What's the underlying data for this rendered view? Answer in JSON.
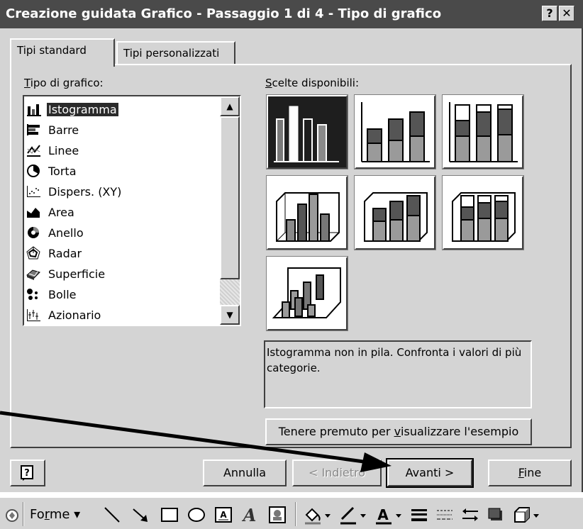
{
  "window": {
    "title": "Creazione guidata Grafico - Passaggio 1 di 4 - Tipo di grafico",
    "help_glyph": "?",
    "close_glyph": "✕"
  },
  "tabs": [
    {
      "label": "Tipi standard",
      "active": true
    },
    {
      "label": "Tipi personalizzati",
      "active": false
    }
  ],
  "chart_type_list": {
    "label_mnemonic": "T",
    "label_rest": "ipo di grafico:",
    "items": [
      {
        "label": "Istogramma",
        "icon": "column-chart-icon",
        "selected": true
      },
      {
        "label": "Barre",
        "icon": "bar-chart-icon"
      },
      {
        "label": "Linee",
        "icon": "line-chart-icon"
      },
      {
        "label": "Torta",
        "icon": "pie-chart-icon"
      },
      {
        "label": "Dispers. (XY)",
        "icon": "scatter-chart-icon"
      },
      {
        "label": "Area",
        "icon": "area-chart-icon"
      },
      {
        "label": "Anello",
        "icon": "doughnut-chart-icon"
      },
      {
        "label": "Radar",
        "icon": "radar-chart-icon"
      },
      {
        "label": "Superficie",
        "icon": "surface-chart-icon"
      },
      {
        "label": "Bolle",
        "icon": "bubble-chart-icon"
      },
      {
        "label": "Azionario",
        "icon": "stock-chart-icon"
      }
    ]
  },
  "subtypes": {
    "label_mnemonic": "S",
    "label_rest": "celte disponibili:",
    "selected_index": 0,
    "description": "Istogramma non in pila. Confronta i valori di più categorie."
  },
  "preview_button": {
    "pre": "Tenere premuto per ",
    "mnemonic": "v",
    "post": "isualizzare l'esempio"
  },
  "footer": {
    "help_icon": "help-icon",
    "cancel_label": "Annulla",
    "back_label": "< Indietro",
    "next_label": "Avanti >",
    "finish_mnemonic": "F",
    "finish_rest": "ine"
  },
  "drawing_toolbar": {
    "forms_pre": "Fo",
    "forms_mnemonic": "r",
    "forms_post": "me ▾"
  }
}
